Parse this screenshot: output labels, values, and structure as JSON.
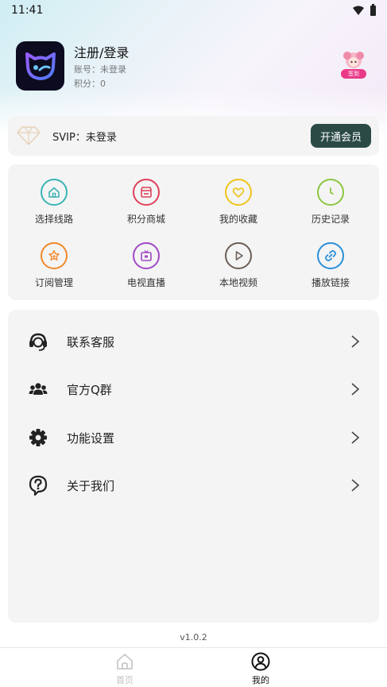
{
  "status_bar": {
    "time": "11:41"
  },
  "profile": {
    "title": "注册/登录",
    "account": "账号：未登录",
    "points": "积分：0",
    "sign_label": "签到"
  },
  "svip": {
    "text": "SVIP：未登录",
    "button": "开通会员"
  },
  "grid": [
    {
      "label": "选择线路",
      "icon": "home-icon",
      "color": "#3bb3b3"
    },
    {
      "label": "积分商城",
      "icon": "store-icon",
      "color": "#e04057"
    },
    {
      "label": "我的收藏",
      "icon": "heart-icon",
      "color": "#f0c419"
    },
    {
      "label": "历史记录",
      "icon": "clock-icon",
      "color": "#8cc63f"
    },
    {
      "label": "订阅管理",
      "icon": "star-add-icon",
      "color": "#f0892b"
    },
    {
      "label": "电视直播",
      "icon": "tv-icon",
      "color": "#a148c4"
    },
    {
      "label": "本地视频",
      "icon": "play-icon",
      "color": "#6b5d55"
    },
    {
      "label": "播放链接",
      "icon": "link-icon",
      "color": "#2a8fd8"
    }
  ],
  "menu": [
    {
      "label": "联系客服",
      "icon": "headset-icon"
    },
    {
      "label": "官方Q群",
      "icon": "group-icon"
    },
    {
      "label": "功能设置",
      "icon": "gear-icon"
    },
    {
      "label": "关于我们",
      "icon": "help-icon"
    }
  ],
  "version": "v1.0.2",
  "tabs": [
    {
      "label": "首页",
      "icon": "home-tab-icon",
      "active": false
    },
    {
      "label": "我的",
      "icon": "user-tab-icon",
      "active": true
    }
  ]
}
